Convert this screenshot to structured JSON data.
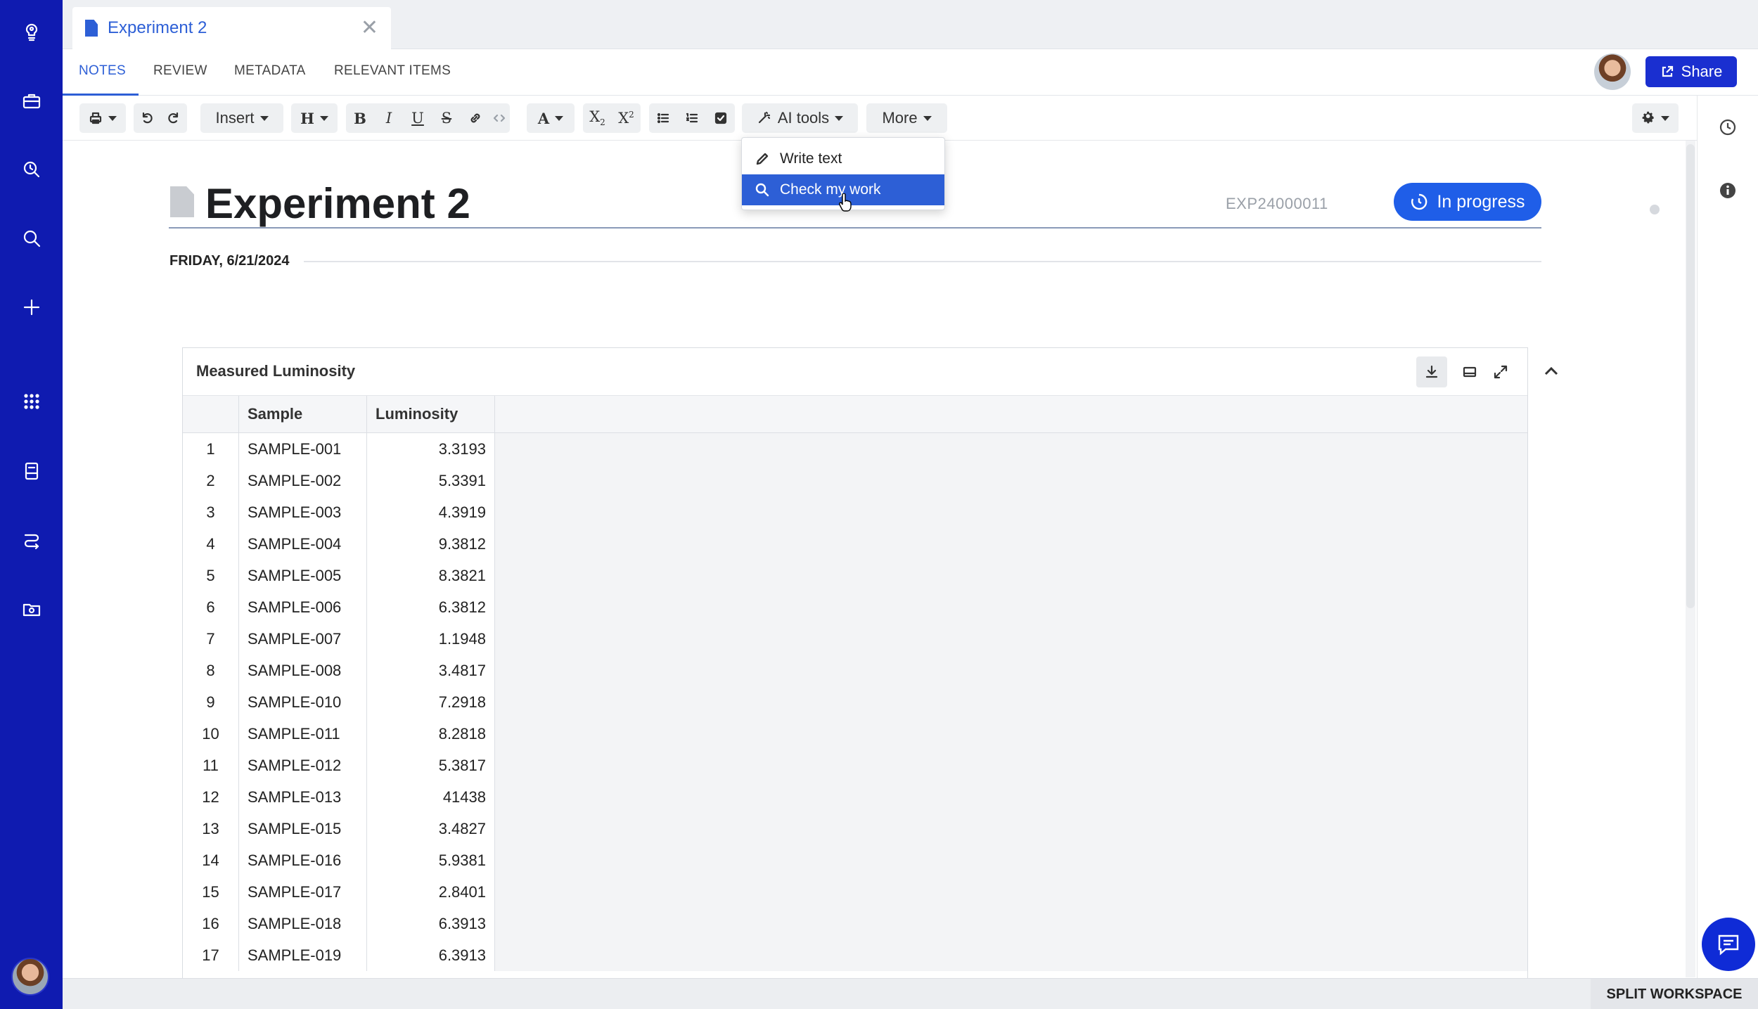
{
  "tab": {
    "title": "Experiment 2",
    "close_label": "✕"
  },
  "section_tabs": [
    {
      "label": "NOTES",
      "active": true
    },
    {
      "label": "REVIEW"
    },
    {
      "label": "METADATA"
    },
    {
      "label": "RELEVANT ITEMS"
    }
  ],
  "share_label": "Share",
  "toolbar": {
    "insert_label": "Insert",
    "heading_label": "H",
    "font_color_label": "A",
    "ai_tools_label": "AI tools",
    "more_label": "More"
  },
  "ai_menu": {
    "items": [
      {
        "label": "Write text",
        "icon": "pencil-icon"
      },
      {
        "label": "Check my work",
        "icon": "search-icon",
        "highlighted": true
      }
    ]
  },
  "document": {
    "title": "Experiment 2",
    "id": "EXP24000011",
    "status": "In progress",
    "date": "FRIDAY, 6/21/2024"
  },
  "table": {
    "title": "Measured Luminosity",
    "columns": [
      "Sample",
      "Luminosity"
    ],
    "rows": [
      {
        "n": "1",
        "sample": "SAMPLE-001",
        "lum": "3.3193"
      },
      {
        "n": "2",
        "sample": "SAMPLE-002",
        "lum": "5.3391"
      },
      {
        "n": "3",
        "sample": "SAMPLE-003",
        "lum": "4.3919"
      },
      {
        "n": "4",
        "sample": "SAMPLE-004",
        "lum": "9.3812"
      },
      {
        "n": "5",
        "sample": "SAMPLE-005",
        "lum": "8.3821"
      },
      {
        "n": "6",
        "sample": "SAMPLE-006",
        "lum": "6.3812"
      },
      {
        "n": "7",
        "sample": "SAMPLE-007",
        "lum": "1.1948"
      },
      {
        "n": "8",
        "sample": "SAMPLE-008",
        "lum": "3.4817"
      },
      {
        "n": "9",
        "sample": "SAMPLE-010",
        "lum": "7.2918"
      },
      {
        "n": "10",
        "sample": "SAMPLE-011",
        "lum": "8.2818"
      },
      {
        "n": "11",
        "sample": "SAMPLE-012",
        "lum": "5.3817"
      },
      {
        "n": "12",
        "sample": "SAMPLE-013",
        "lum": "41438"
      },
      {
        "n": "13",
        "sample": "SAMPLE-015",
        "lum": "3.4827"
      },
      {
        "n": "14",
        "sample": "SAMPLE-016",
        "lum": "5.9381"
      },
      {
        "n": "15",
        "sample": "SAMPLE-017",
        "lum": "2.8401"
      },
      {
        "n": "16",
        "sample": "SAMPLE-018",
        "lum": "6.3913"
      },
      {
        "n": "17",
        "sample": "SAMPLE-019",
        "lum": "6.3913"
      }
    ]
  },
  "statusbar": {
    "split_label": "SPLIT WORKSPACE"
  },
  "colors": {
    "nav_bg": "#0f1bb0",
    "accent": "#2d5fd6",
    "share_bg": "#1a2fd0",
    "status_bg": "#1f5ee8"
  }
}
